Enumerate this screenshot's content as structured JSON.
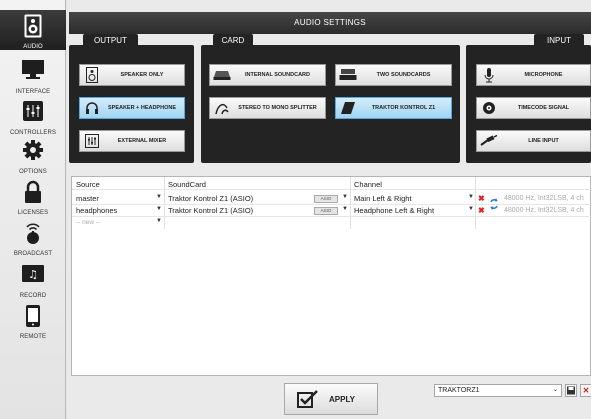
{
  "sidebar": {
    "items": [
      {
        "label": "AUDIO",
        "icon": "speaker-icon"
      },
      {
        "label": "INTERFACE",
        "icon": "monitor-icon"
      },
      {
        "label": "CONTROLLERS",
        "icon": "controller-icon"
      },
      {
        "label": "OPTIONS",
        "icon": "gear-icon"
      },
      {
        "label": "LICENSES",
        "icon": "lock-icon"
      },
      {
        "label": "BROADCAST",
        "icon": "broadcast-icon"
      },
      {
        "label": "RECORD",
        "icon": "record-icon"
      },
      {
        "label": "REMOTE",
        "icon": "tablet-icon"
      }
    ]
  },
  "title": "AUDIO SETTINGS",
  "output": {
    "tab": "OUTPUT",
    "options": [
      "SPEAKER ONLY",
      "SPEAKER + HEADPHONE",
      "EXTERNAL MIXER"
    ]
  },
  "card": {
    "tab": "CARD",
    "options": [
      "INTERNAL SOUNDCARD",
      "TWO SOUNDCARDS",
      "STEREO TO MONO SPLITTER",
      "TRAKTOR KONTROL Z1"
    ]
  },
  "input": {
    "tab": "INPUT",
    "options": [
      "MICROPHONE",
      "TIMECODE SIGNAL",
      "LINE INPUT"
    ]
  },
  "table": {
    "headers": [
      "Source",
      "SoundCard",
      "Channel"
    ],
    "rows": [
      {
        "source": "master",
        "soundcard": "Traktor Kontrol Z1 (ASIO)",
        "asio": "ASIO",
        "channel": "Main Left & Right",
        "format": "48000 Hz, Int32LSB, 4 ch"
      },
      {
        "source": "headphones",
        "soundcard": "Traktor Kontrol Z1 (ASIO)",
        "asio": "ASIO",
        "channel": "Headphone Left & Right",
        "format": "48000 Hz, Int32LSB, 4 ch"
      }
    ],
    "new_placeholder": "-- new --"
  },
  "apply_label": "APPLY",
  "preset": {
    "value": "TRAKTORZ1"
  },
  "colors": {
    "accent_selected": "#9fd4f2",
    "panel": "#232323",
    "title": "#333333"
  }
}
